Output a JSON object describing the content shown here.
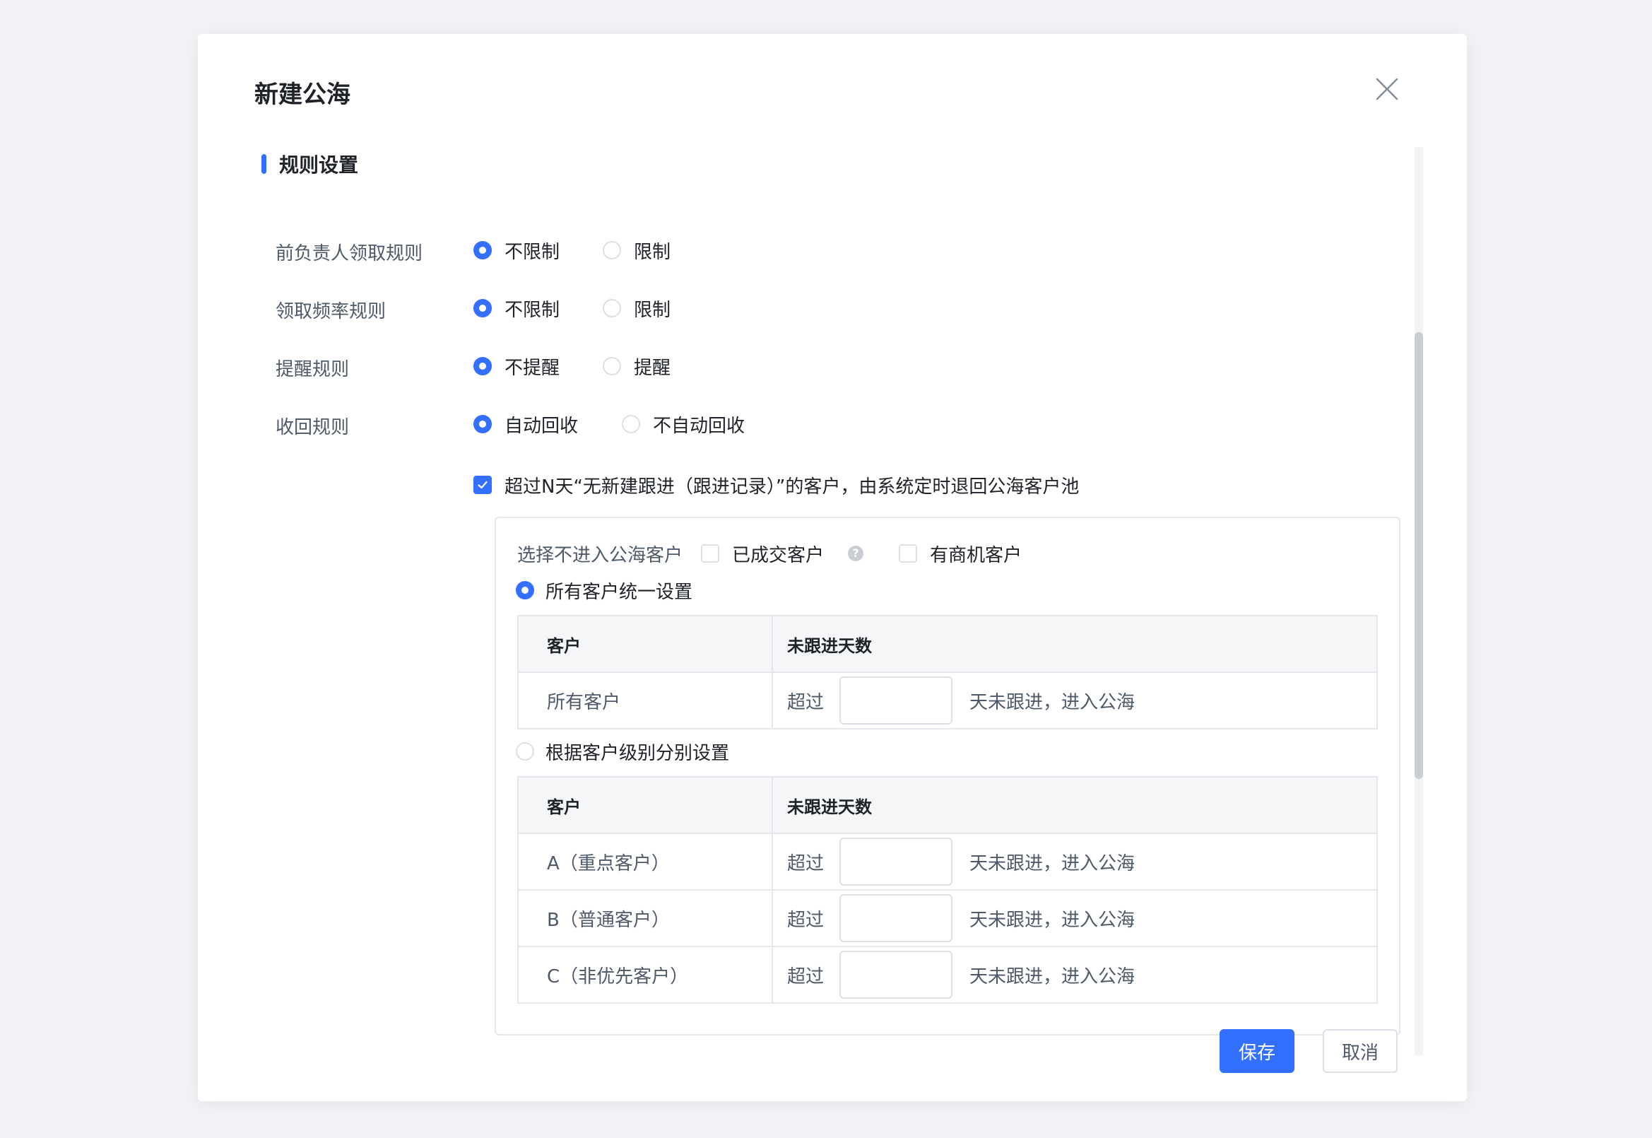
{
  "dialog": {
    "title": "新建公海",
    "close_icon": "close-icon"
  },
  "section": {
    "title": "规则设置"
  },
  "rules": [
    {
      "label": "前负责人领取规则",
      "options": [
        {
          "label": "不限制",
          "selected": true
        },
        {
          "label": "限制",
          "selected": false
        }
      ]
    },
    {
      "label": "领取频率规则",
      "options": [
        {
          "label": "不限制",
          "selected": true
        },
        {
          "label": "限制",
          "selected": false
        }
      ]
    },
    {
      "label": "提醒规则",
      "options": [
        {
          "label": "不提醒",
          "selected": true
        },
        {
          "label": "提醒",
          "selected": false
        }
      ]
    },
    {
      "label": "收回规则",
      "options": [
        {
          "label": "自动回收",
          "selected": true
        },
        {
          "label": "不自动回收",
          "selected": false
        }
      ]
    }
  ],
  "auto_return": {
    "checked": true,
    "label": "超过N天“无新建跟进（跟进记录）”的客户，由系统定时退回公海客户池"
  },
  "exclude": {
    "label": "选择不进入公海客户",
    "options": [
      {
        "label": "已成交客户",
        "checked": false,
        "help_icon": "question-mark-icon",
        "help_glyph": "?"
      },
      {
        "label": "有商机客户",
        "checked": false
      }
    ]
  },
  "mode_all": {
    "label": "所有客户统一设置",
    "selected": true,
    "columns": [
      "客户",
      "未跟进天数"
    ],
    "rows": [
      {
        "customer": "所有客户",
        "prefix": "超过",
        "value": "",
        "suffix": "天未跟进，进入公海"
      }
    ]
  },
  "mode_level": {
    "label": "根据客户级别分别设置",
    "selected": false,
    "columns": [
      "客户",
      "未跟进天数"
    ],
    "rows": [
      {
        "customer": "A（重点客户）",
        "prefix": "超过",
        "value": "",
        "suffix": "天未跟进，进入公海"
      },
      {
        "customer": "B（普通客户）",
        "prefix": "超过",
        "value": "",
        "suffix": "天未跟进，进入公海"
      },
      {
        "customer": "C（非优先客户）",
        "prefix": "超过",
        "value": "",
        "suffix": "天未跟进，进入公海"
      }
    ]
  },
  "footer": {
    "save_label": "保存",
    "cancel_label": "取消"
  },
  "colors": {
    "accent": "#3370ff",
    "border": "#e5e6eb",
    "header_bg": "#f5f6f7",
    "page_bg": "#f0f2f5"
  }
}
